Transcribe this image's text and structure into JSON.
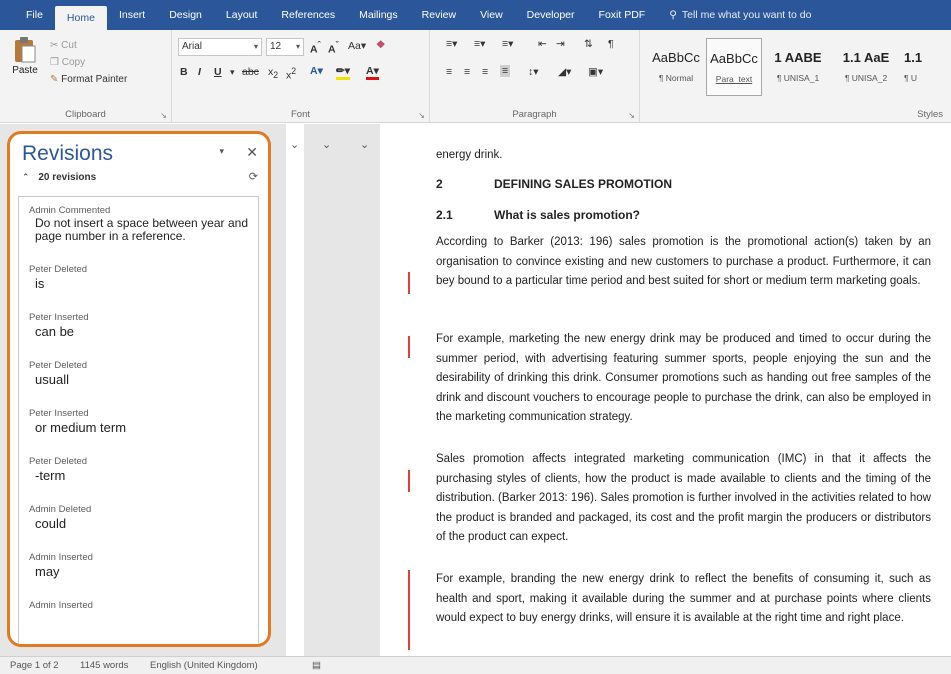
{
  "tabs": [
    "File",
    "Home",
    "Insert",
    "Design",
    "Layout",
    "References",
    "Mailings",
    "Review",
    "View",
    "Developer",
    "Foxit PDF"
  ],
  "active_tab": "Home",
  "tell_me": "Tell me what you want to do",
  "clipboard": {
    "paste": "Paste",
    "cut": "Cut",
    "copy": "Copy",
    "format_painter": "Format Painter",
    "label": "Clipboard"
  },
  "font": {
    "name": "Arial",
    "size": "12",
    "label": "Font"
  },
  "paragraph": {
    "label": "Paragraph"
  },
  "styles": {
    "label": "Styles",
    "tiles": [
      {
        "sample": "AaBbCc",
        "name": "¶ Normal"
      },
      {
        "sample": "AaBbCc",
        "name": "Para_text"
      },
      {
        "sample": "1 AABE",
        "name": "¶ UNISA_1"
      },
      {
        "sample": "1.1 AaE",
        "name": "¶ UNISA_2"
      },
      {
        "sample": "1.1",
        "name": "¶ U"
      }
    ]
  },
  "revisions_pane": {
    "title": "Revisions",
    "count": "20 revisions",
    "items": [
      {
        "head": "Admin Commented",
        "body": "Do not insert a space between year and page number in a reference."
      },
      {
        "head": "Peter Deleted",
        "body": "is"
      },
      {
        "head": "Peter Inserted",
        "body": "can be"
      },
      {
        "head": "Peter Deleted",
        "body": "usuall"
      },
      {
        "head": "Peter Inserted",
        "body": "or medium term"
      },
      {
        "head": "Peter Deleted",
        "body": "-term"
      },
      {
        "head": "Admin Deleted",
        "body": "could"
      },
      {
        "head": "Admin Inserted",
        "body": "may"
      },
      {
        "head": "Admin Inserted",
        "body": ""
      }
    ]
  },
  "document": {
    "lead": "energy drink.",
    "heading_2": {
      "num": "2",
      "text": "DEFINING SALES PROMOTION"
    },
    "heading_21": {
      "num": "2.1",
      "text": "What is sales promotion?"
    },
    "paragraphs": [
      "According to Barker (2013: 196) sales promotion is the promotional action(s) taken by an organisation to convince existing and new customers to purchase a product. Furthermore, it can bey bound to a particular time period and best suited for short or medium term marketing goals.",
      "For example, marketing the new energy drink may be produced and timed to occur during the summer period, with advertising featuring summer sports, people enjoying the sun and the desirability of drinking this drink. Consumer promotions such as handing out free samples of the drink and discount vouchers to encourage people to purchase the drink, can also be employed in the marketing communication strategy.",
      "Sales promotion affects integrated marketing communication (IMC) in that it affects the purchasing styles of clients, how the product is made available to clients and the timing of the distribution. (Barker 2013: 196). Sales promotion is further involved in the activities related to how the product is branded and packaged, its cost and the profit margin the producers or distributors of the product can expect.",
      "For example, branding the new energy drink to reflect the benefits of consuming it, such as health and sport, making it available during the summer and at purchase points where clients would expect to buy energy drinks, will ensure it is available at the right time and right place."
    ]
  },
  "status": {
    "page": "Page 1 of 2",
    "words": "1145 words",
    "language": "English (United Kingdom)"
  },
  "colors": {
    "ribbon_blue": "#2b579a",
    "highlight_orange": "#e07b22",
    "revision_red": "#e03c3c"
  }
}
